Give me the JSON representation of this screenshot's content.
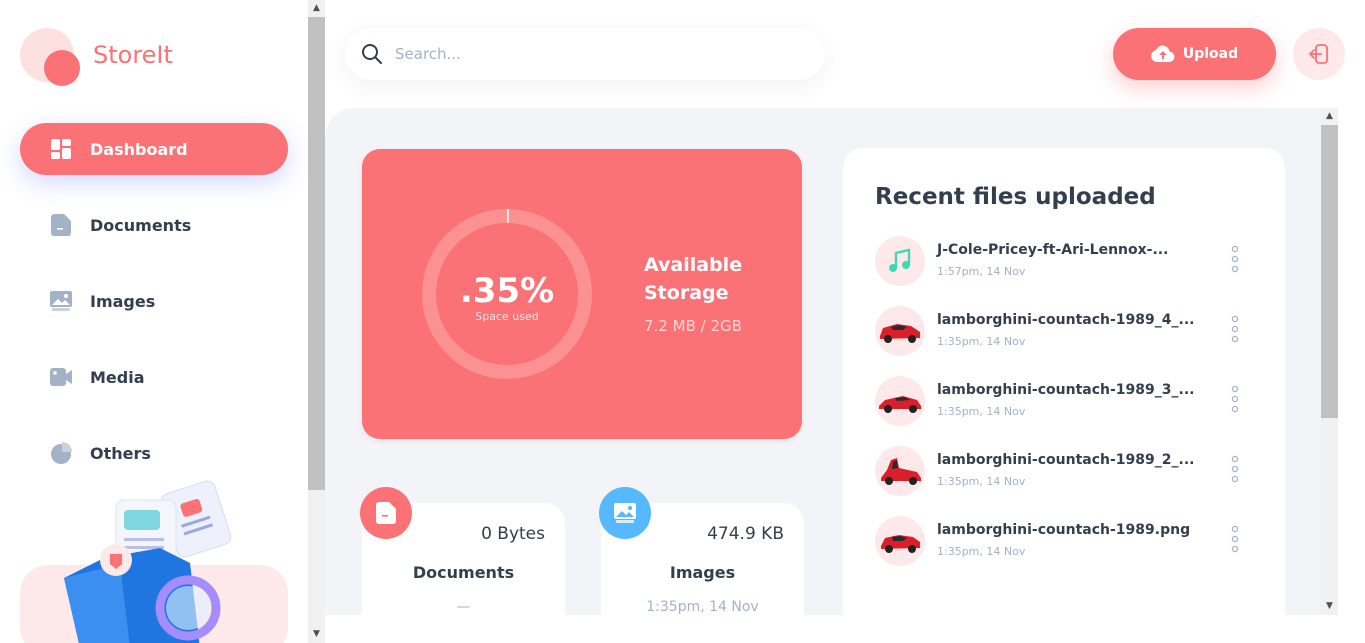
{
  "app": {
    "name": "StoreIt"
  },
  "sidebar": {
    "items": [
      {
        "label": "Dashboard",
        "icon": "dashboard-icon",
        "active": true
      },
      {
        "label": "Documents",
        "icon": "document-icon",
        "active": false
      },
      {
        "label": "Images",
        "icon": "images-icon",
        "active": false
      },
      {
        "label": "Media",
        "icon": "video-icon",
        "active": false
      },
      {
        "label": "Others",
        "icon": "pie-chart-icon",
        "active": false
      }
    ]
  },
  "header": {
    "search_placeholder": "Search...",
    "upload_label": "Upload"
  },
  "storage": {
    "percent_label": ".35%",
    "percent_value": 0.35,
    "percent_sub": "Space used",
    "title": "Available Storage",
    "usage": "7.2 MB / 2GB"
  },
  "summary": [
    {
      "size": "0 Bytes",
      "name": "Documents",
      "date": "—",
      "icon": "document-icon",
      "color": "#fa7275"
    },
    {
      "size": "474.9 KB",
      "name": "Images",
      "date": "1:35pm, 14 Nov",
      "icon": "images-icon",
      "color": "#56b8ff"
    }
  ],
  "recent": {
    "title": "Recent files uploaded",
    "files": [
      {
        "name": "J-Cole-Pricey-ft-Ari-Lennox-...",
        "date": "1:57pm, 14 Nov",
        "type": "audio"
      },
      {
        "name": "lamborghini-countach-1989_4_...",
        "date": "1:35pm, 14 Nov",
        "type": "image"
      },
      {
        "name": "lamborghini-countach-1989_3_...",
        "date": "1:35pm, 14 Nov",
        "type": "image"
      },
      {
        "name": "lamborghini-countach-1989_2_...",
        "date": "1:35pm, 14 Nov",
        "type": "image"
      },
      {
        "name": "lamborghini-countach-1989.png",
        "date": "1:35pm, 14 Nov",
        "type": "image"
      }
    ]
  },
  "colors": {
    "brand": "#fa7275",
    "text": "#333f4e",
    "muted": "#a3b2c7",
    "blue": "#56b8ff",
    "audio": "#3dd9b3"
  }
}
